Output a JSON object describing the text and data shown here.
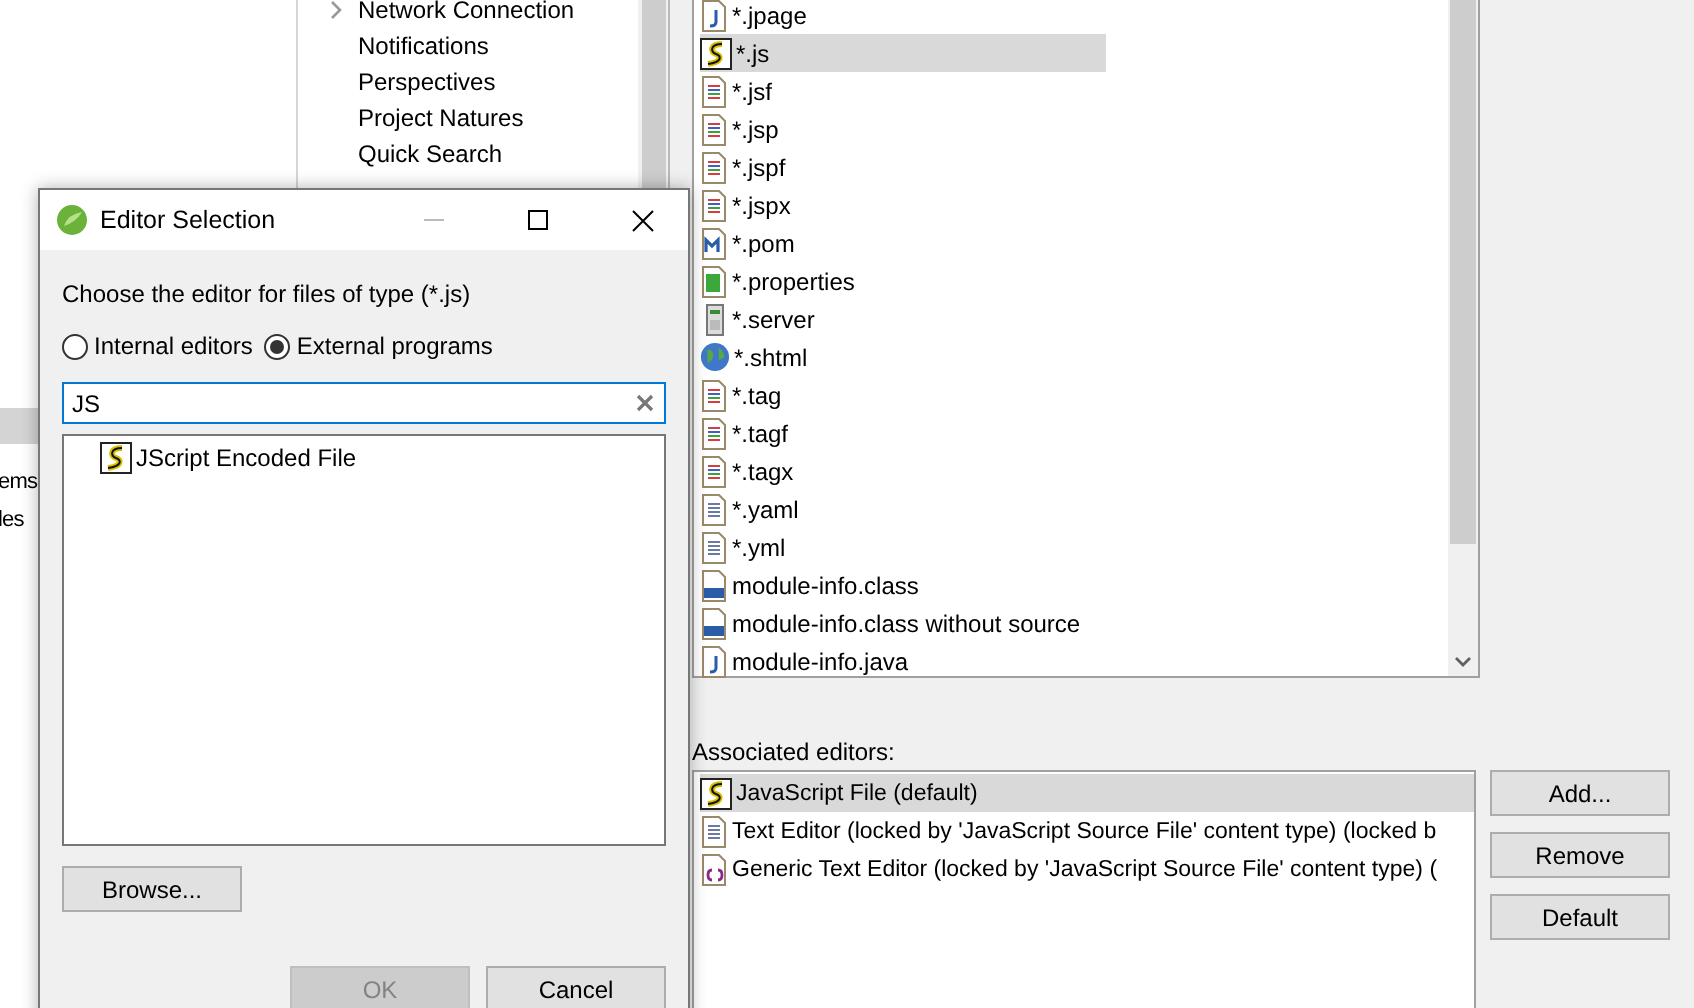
{
  "background": {
    "tree": [
      {
        "label": "Network Connection",
        "expandable": true
      },
      {
        "label": "Notifications",
        "expandable": false
      },
      {
        "label": "Perspectives",
        "expandable": false
      },
      {
        "label": "Project Natures",
        "expandable": false
      },
      {
        "label": "Quick Search",
        "expandable": false
      }
    ],
    "left_list": [
      "ems",
      "les"
    ],
    "file_types": [
      {
        "label": "*.jpage",
        "kind": "jpage",
        "selected": false
      },
      {
        "label": "*.js",
        "kind": "script",
        "selected": true
      },
      {
        "label": "*.jsf",
        "kind": "web",
        "selected": false
      },
      {
        "label": "*.jsp",
        "kind": "web",
        "selected": false
      },
      {
        "label": "*.jspf",
        "kind": "web",
        "selected": false
      },
      {
        "label": "*.jspx",
        "kind": "web",
        "selected": false
      },
      {
        "label": "*.pom",
        "kind": "maven",
        "selected": false
      },
      {
        "label": "*.properties",
        "kind": "properties",
        "selected": false
      },
      {
        "label": "*.server",
        "kind": "server",
        "selected": false
      },
      {
        "label": "*.shtml",
        "kind": "globe",
        "selected": false
      },
      {
        "label": "*.tag",
        "kind": "web",
        "selected": false
      },
      {
        "label": "*.tagf",
        "kind": "web",
        "selected": false
      },
      {
        "label": "*.tagx",
        "kind": "web",
        "selected": false
      },
      {
        "label": "*.yaml",
        "kind": "text",
        "selected": false
      },
      {
        "label": "*.yml",
        "kind": "text",
        "selected": false
      },
      {
        "label": "module-info.class",
        "kind": "class",
        "selected": false
      },
      {
        "label": "module-info.class without source",
        "kind": "class",
        "selected": false
      },
      {
        "label": "module-info.java",
        "kind": "java",
        "selected": false
      }
    ],
    "associated_editors": {
      "label": "Associated editors:",
      "items": [
        {
          "label": "JavaScript File (default)",
          "kind": "script",
          "selected": true
        },
        {
          "label": "Text Editor (locked by 'JavaScript Source File' content type) (locked b",
          "kind": "text",
          "selected": false
        },
        {
          "label": "Generic Text Editor (locked by 'JavaScript Source File' content type) (",
          "kind": "generic",
          "selected": false
        }
      ]
    },
    "buttons": [
      "Add...",
      "Remove",
      "Default"
    ]
  },
  "dialog": {
    "title": "Editor Selection",
    "prompt": "Choose the editor for files of type (*.js)",
    "radios": [
      {
        "label": "Internal editors",
        "selected": false
      },
      {
        "label": "External programs",
        "selected": true
      }
    ],
    "search": {
      "value": "JS"
    },
    "programs": [
      {
        "label": "JScript Encoded File",
        "kind": "script"
      }
    ],
    "browse": "Browse...",
    "buttons": [
      {
        "label": "OK",
        "disabled": true
      },
      {
        "label": "Cancel",
        "disabled": false
      }
    ]
  }
}
